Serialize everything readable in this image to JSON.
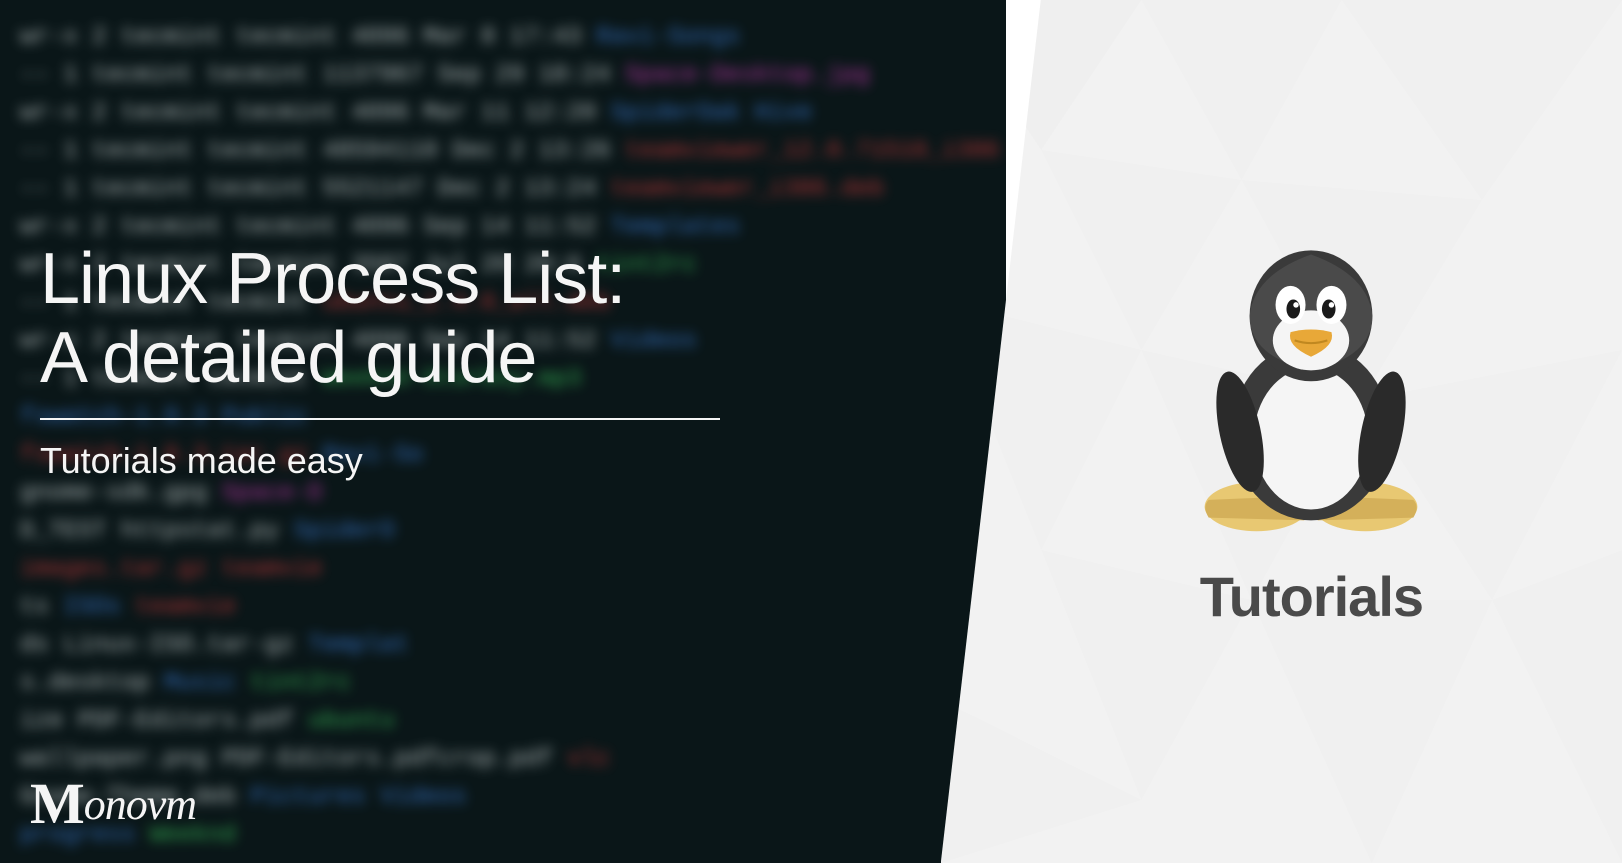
{
  "title_line1": "Linux Process List:",
  "title_line2": "A detailed guide",
  "subtitle": "Tutorials made easy",
  "logo_text": "onovm",
  "right_panel_text": "Tutorials",
  "terminal_lines": [
    {
      "prefix": "wr-x  2  tecmint  tecmint        4096  Mar   8  17:43  ",
      "file": "Ravi-Songs",
      "color": "blue"
    },
    {
      "prefix": "--    1  tecmint  tecmint     1137967  Sep  29  18:24  ",
      "file": "Space-Desktop.jpg",
      "color": "magenta"
    },
    {
      "prefix": "wr-x  2  tecmint  tecmint        4096  Mar  11  12:20  ",
      "file": "SpiderOak Hive",
      "color": "blue"
    },
    {
      "prefix": "--    1  tecmint  tecmint    48594110  Dec   2  13:26  ",
      "file": "teamviewer_12.0.71510_i386",
      "color": "red"
    },
    {
      "prefix": "--    1  tecmint  tecmint     5521147  Dec   2  13:24  ",
      "file": "teamviewer_i386.deb",
      "color": "red"
    },
    {
      "prefix": "wr-x  2  tecmint  tecmint        4096  Sep  14  11:52  ",
      "file": "Templates",
      "color": "blue"
    },
    {
      "prefix": "wr-x  2  tecmint  tecmint        3507  Jul  20  20:6  ",
      "file": "tint2rc",
      "color": "green"
    },
    {
      "prefix": "",
      "file": "",
      "color": "white"
    },
    {
      "prefix": "--    1  tecmint  tecmint               ",
      "file": "ubuntu_1.4.0_all.deb",
      "color": "red"
    },
    {
      "prefix": "wr-x  2  tecmint  tecmint        4096  Sep  14  11:52  ",
      "file": "Videos",
      "color": "blue"
    },
    {
      "prefix": "--    1  tecmint  tecmint                   ",
      "file": "Weeknd-Starboy.mp3",
      "color": "green"
    },
    {
      "prefix": "",
      "file": "",
      "color": "white"
    },
    {
      "prefix": "                                            ",
      "file": "fswatch-1.9.3",
      "color": "blue",
      "suffix": "Public",
      "suffixColor": "blue"
    },
    {
      "prefix": "                                            ",
      "file": "fswatch-1.9.3.tar.gz",
      "color": "red",
      "suffix": "Ravi-So",
      "suffixColor": "blue"
    },
    {
      "prefix": "                                            ",
      "file": "gnome-sdk.gpg",
      "color": "white",
      "suffix": "Space-D",
      "suffixColor": "magenta"
    },
    {
      "prefix": "D_TEST                                      ",
      "file": "httpstat.py",
      "color": "white",
      "suffix": "SpiderO",
      "suffixColor": "blue"
    },
    {
      "prefix": "                                            ",
      "file": "images.tar.gz",
      "color": "red",
      "suffix": "teamvie",
      "suffixColor": "red"
    },
    {
      "prefix": "ts                                          ",
      "file": "ISOs",
      "color": "blue",
      "suffix": "teamvie",
      "suffixColor": "red"
    },
    {
      "prefix": "ds                                          ",
      "file": "Linux-ISO.tar-gz",
      "color": "white",
      "suffix": "Templat",
      "suffixColor": "blue"
    },
    {
      "prefix": "s.desktop                                   ",
      "file": "Music",
      "color": "blue",
      "suffix": "tint2rc",
      "suffixColor": "green"
    },
    {
      "prefix": "ize                                         ",
      "file": "PDF-Editors.pdf",
      "color": "white",
      "suffix": "ubuntu",
      "suffixColor": "green"
    },
    {
      "prefix": "wallpaper.png                               ",
      "file": "PDF-Editors.pdfcrop.pdf",
      "color": "white",
      "suffix": "vlc",
      "suffixColor": "red"
    },
    {
      "prefix": "Gnome-Theme.deb                             ",
      "file": "Pictures",
      "color": "blue",
      "suffix": "Videos",
      "suffixColor": "blue"
    },
    {
      "prefix": "                                            ",
      "file": "progress",
      "color": "blue",
      "suffix": "Weeknd",
      "suffixColor": "green"
    }
  ]
}
